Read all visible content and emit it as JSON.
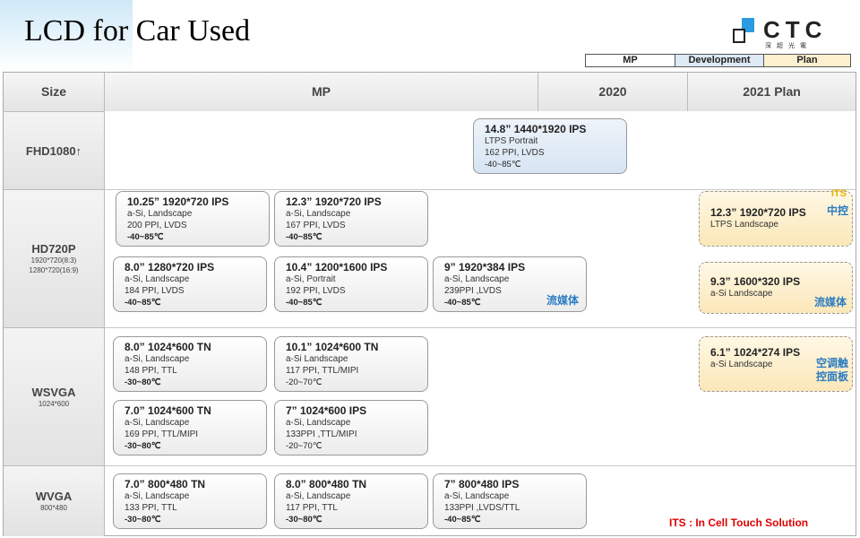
{
  "title": "LCD for Car Used",
  "logo": {
    "text": "CTC",
    "subtext": "深超光電"
  },
  "legend": {
    "mp": "MP",
    "development": "Development",
    "plan": "Plan"
  },
  "headers": {
    "size": "Size",
    "mp": "MP",
    "y2020": "2020",
    "plan2021": "2021 Plan"
  },
  "rows": [
    {
      "main": "FHD1080↑",
      "sub": []
    },
    {
      "main": "HD720P",
      "sub": [
        "1920*720(8:3)",
        "1280*720(16:9)"
      ]
    },
    {
      "main": "WSVGA",
      "sub": [
        "1024*600"
      ]
    },
    {
      "main": "WVGA",
      "sub": [
        "800*480"
      ]
    }
  ],
  "cards": [
    {
      "title": "14.8” 1440*1920 IPS",
      "l1": "LTPS Portrait",
      "l2": "162 PPI,  LVDS",
      "temp": "-40~85℃"
    },
    {
      "title": "10.25” 1920*720 IPS",
      "l1": "a-Si, Landscape",
      "l2": "200 PPI, LVDS",
      "temp": "-40~85℃"
    },
    {
      "title": "12.3” 1920*720 IPS",
      "l1": "a-Si, Landscape",
      "l2": "167 PPI, LVDS",
      "temp": "-40~85℃"
    },
    {
      "title": "8.0” 1280*720 IPS",
      "l1": "a-Si, Landscape",
      "l2": "184 PPI, LVDS",
      "temp": "-40~85℃"
    },
    {
      "title": "10.4” 1200*1600 IPS",
      "l1": "a-Si, Portrait",
      "l2": "192 PPI, LVDS",
      "temp": "-40~85℃"
    },
    {
      "title": "9” 1920*384 IPS",
      "l1": "a-Si, Landscape",
      "l2": "239PPI ,LVDS",
      "temp": "-40~85℃",
      "tag": "流媒体"
    },
    {
      "title": "8.0” 1024*600 TN",
      "l1": "a-Si, Landscape",
      "l2": "148 PPI, TTL",
      "temp": "-30~80℃"
    },
    {
      "title": "10.1” 1024*600 TN",
      "l1": "a-Si Landscape",
      "l2": "117 PPI,  TTL/MIPI",
      "temp": "-20~70℃"
    },
    {
      "title": "7.0” 1024*600 TN",
      "l1": "a-Si, Landscape",
      "l2": "169 PPI, TTL/MIPI",
      "temp": "-30~80℃"
    },
    {
      "title": "7” 1024*600 IPS",
      "l1": "a-Si, Landscape",
      "l2": "133PPI ,TTL/MIPI",
      "temp": "-20~70℃"
    },
    {
      "title": "7.0” 800*480 TN",
      "l1": "a-Si, Landscape",
      "l2": "133 PPI, TTL",
      "temp": "-30~80℃"
    },
    {
      "title": "8.0” 800*480 TN",
      "l1": "a-Si, Landscape",
      "l2": "117 PPI, TTL",
      "temp": "-30~80℃"
    },
    {
      "title": "7” 800*480 IPS",
      "l1": "a-Si, Landscape",
      "l2": "133PPI ,LVDS/TTL",
      "temp": "-40~85℃"
    },
    {
      "title": "12.3” 1920*720 IPS",
      "l1": "LTPS  Landscape",
      "its": "ITS",
      "tag": "中控"
    },
    {
      "title": "9.3” 1600*320 IPS",
      "l1": "a-Si    Landscape",
      "tag": "流媒体"
    },
    {
      "title": "6.1”  1024*274 IPS",
      "l1": "a-Si   Landscape",
      "tag1": "空调触",
      "tag2": "控面板"
    }
  ],
  "footnote": "ITS : In Cell Touch Solution",
  "colors": {
    "tag_blue": "#2b7cc2",
    "its_yellow": "#e8b200",
    "footnote_red": "#e00000"
  }
}
